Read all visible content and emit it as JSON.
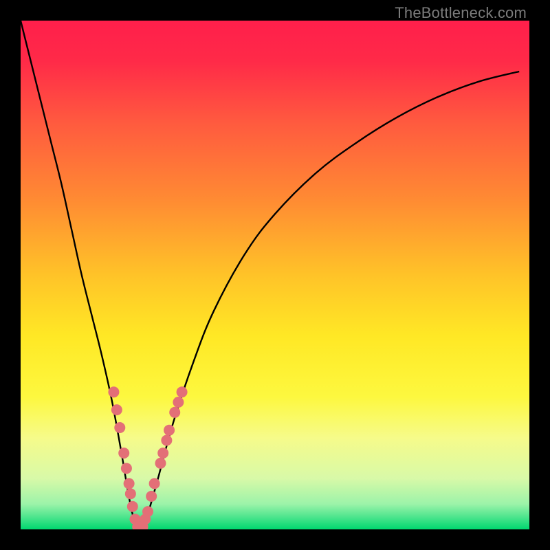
{
  "watermark": {
    "text": "TheBottleneck.com"
  },
  "chart_data": {
    "type": "line",
    "title": "",
    "xlabel": "",
    "ylabel": "",
    "xlim": [
      0,
      100
    ],
    "ylim": [
      0,
      100
    ],
    "gradient_stops": [
      {
        "offset": 0.0,
        "color": "#ff1f4b"
      },
      {
        "offset": 0.08,
        "color": "#ff2a48"
      },
      {
        "offset": 0.2,
        "color": "#ff5a3f"
      },
      {
        "offset": 0.35,
        "color": "#ff8a33"
      },
      {
        "offset": 0.5,
        "color": "#ffc328"
      },
      {
        "offset": 0.62,
        "color": "#ffe825"
      },
      {
        "offset": 0.74,
        "color": "#fdf83f"
      },
      {
        "offset": 0.82,
        "color": "#f6fb8a"
      },
      {
        "offset": 0.9,
        "color": "#d8f9a8"
      },
      {
        "offset": 0.95,
        "color": "#9cf3a9"
      },
      {
        "offset": 0.975,
        "color": "#4fe58e"
      },
      {
        "offset": 1.0,
        "color": "#00d76f"
      }
    ],
    "series": [
      {
        "name": "bottleneck-curve",
        "x": [
          0,
          2,
          4,
          6,
          8,
          10,
          12,
          14,
          16,
          18,
          20,
          21,
          22,
          23,
          24,
          25,
          27,
          30,
          34,
          38,
          44,
          50,
          58,
          66,
          74,
          82,
          90,
          98
        ],
        "y": [
          100,
          92,
          84,
          76,
          68,
          59,
          50,
          42,
          34,
          25,
          14,
          8,
          3,
          0,
          0,
          3,
          10,
          21,
          33,
          43,
          54,
          62,
          70,
          76,
          81,
          85,
          88,
          90
        ]
      }
    ],
    "markers": {
      "name": "highlight-dots",
      "color": "#e36f77",
      "points": [
        {
          "x": 18.3,
          "y": 27.0
        },
        {
          "x": 18.9,
          "y": 23.5
        },
        {
          "x": 19.5,
          "y": 20.0
        },
        {
          "x": 20.3,
          "y": 15.0
        },
        {
          "x": 20.8,
          "y": 12.0
        },
        {
          "x": 21.3,
          "y": 9.0
        },
        {
          "x": 21.6,
          "y": 7.0
        },
        {
          "x": 22.0,
          "y": 4.5
        },
        {
          "x": 22.5,
          "y": 2.0
        },
        {
          "x": 23.0,
          "y": 0.5
        },
        {
          "x": 23.5,
          "y": 0.0
        },
        {
          "x": 24.0,
          "y": 0.5
        },
        {
          "x": 24.5,
          "y": 2.0
        },
        {
          "x": 25.0,
          "y": 3.5
        },
        {
          "x": 25.7,
          "y": 6.5
        },
        {
          "x": 26.3,
          "y": 9.0
        },
        {
          "x": 27.5,
          "y": 13.0
        },
        {
          "x": 28.0,
          "y": 15.0
        },
        {
          "x": 28.7,
          "y": 17.5
        },
        {
          "x": 29.2,
          "y": 19.5
        },
        {
          "x": 30.3,
          "y": 23.0
        },
        {
          "x": 31.0,
          "y": 25.0
        },
        {
          "x": 31.7,
          "y": 27.0
        }
      ]
    }
  }
}
